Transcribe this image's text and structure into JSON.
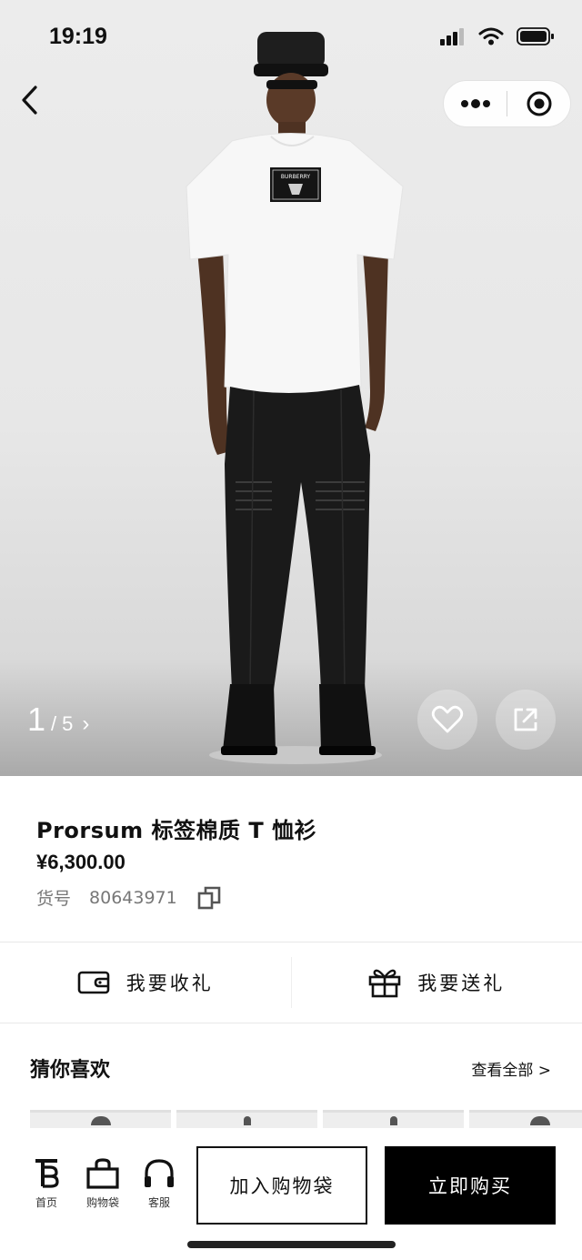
{
  "status_bar": {
    "time": "19:19"
  },
  "gallery": {
    "current": "1",
    "separator": "/",
    "total": "5",
    "next_glyph": "›"
  },
  "product": {
    "title": "Prorsum 标签棉质 T 恤衫",
    "price": "¥6,300.00",
    "sku_label": "货号",
    "sku_value": "80643971",
    "logo_patch_text": "BURBERRY"
  },
  "gift": {
    "receive_label": "我要收礼",
    "send_label": "我要送礼"
  },
  "recommend": {
    "title": "猜你喜欢",
    "view_all": "查看全部 >"
  },
  "bottom_nav": {
    "home_label": "首页",
    "bag_label": "购物袋",
    "service_label": "客服",
    "add_to_bag": "加入购物袋",
    "buy_now": "立即购买"
  },
  "icons": [
    "back-arrow-icon",
    "more-dots-icon",
    "record-target-icon",
    "heart-icon",
    "share-icon",
    "copy-icon",
    "wallet-icon",
    "gift-icon",
    "burberry-tb-logo-icon",
    "shopping-bag-icon",
    "headset-icon"
  ],
  "colors": {
    "primary": "#000000",
    "background": "#ffffff",
    "muted_text": "#777777"
  }
}
